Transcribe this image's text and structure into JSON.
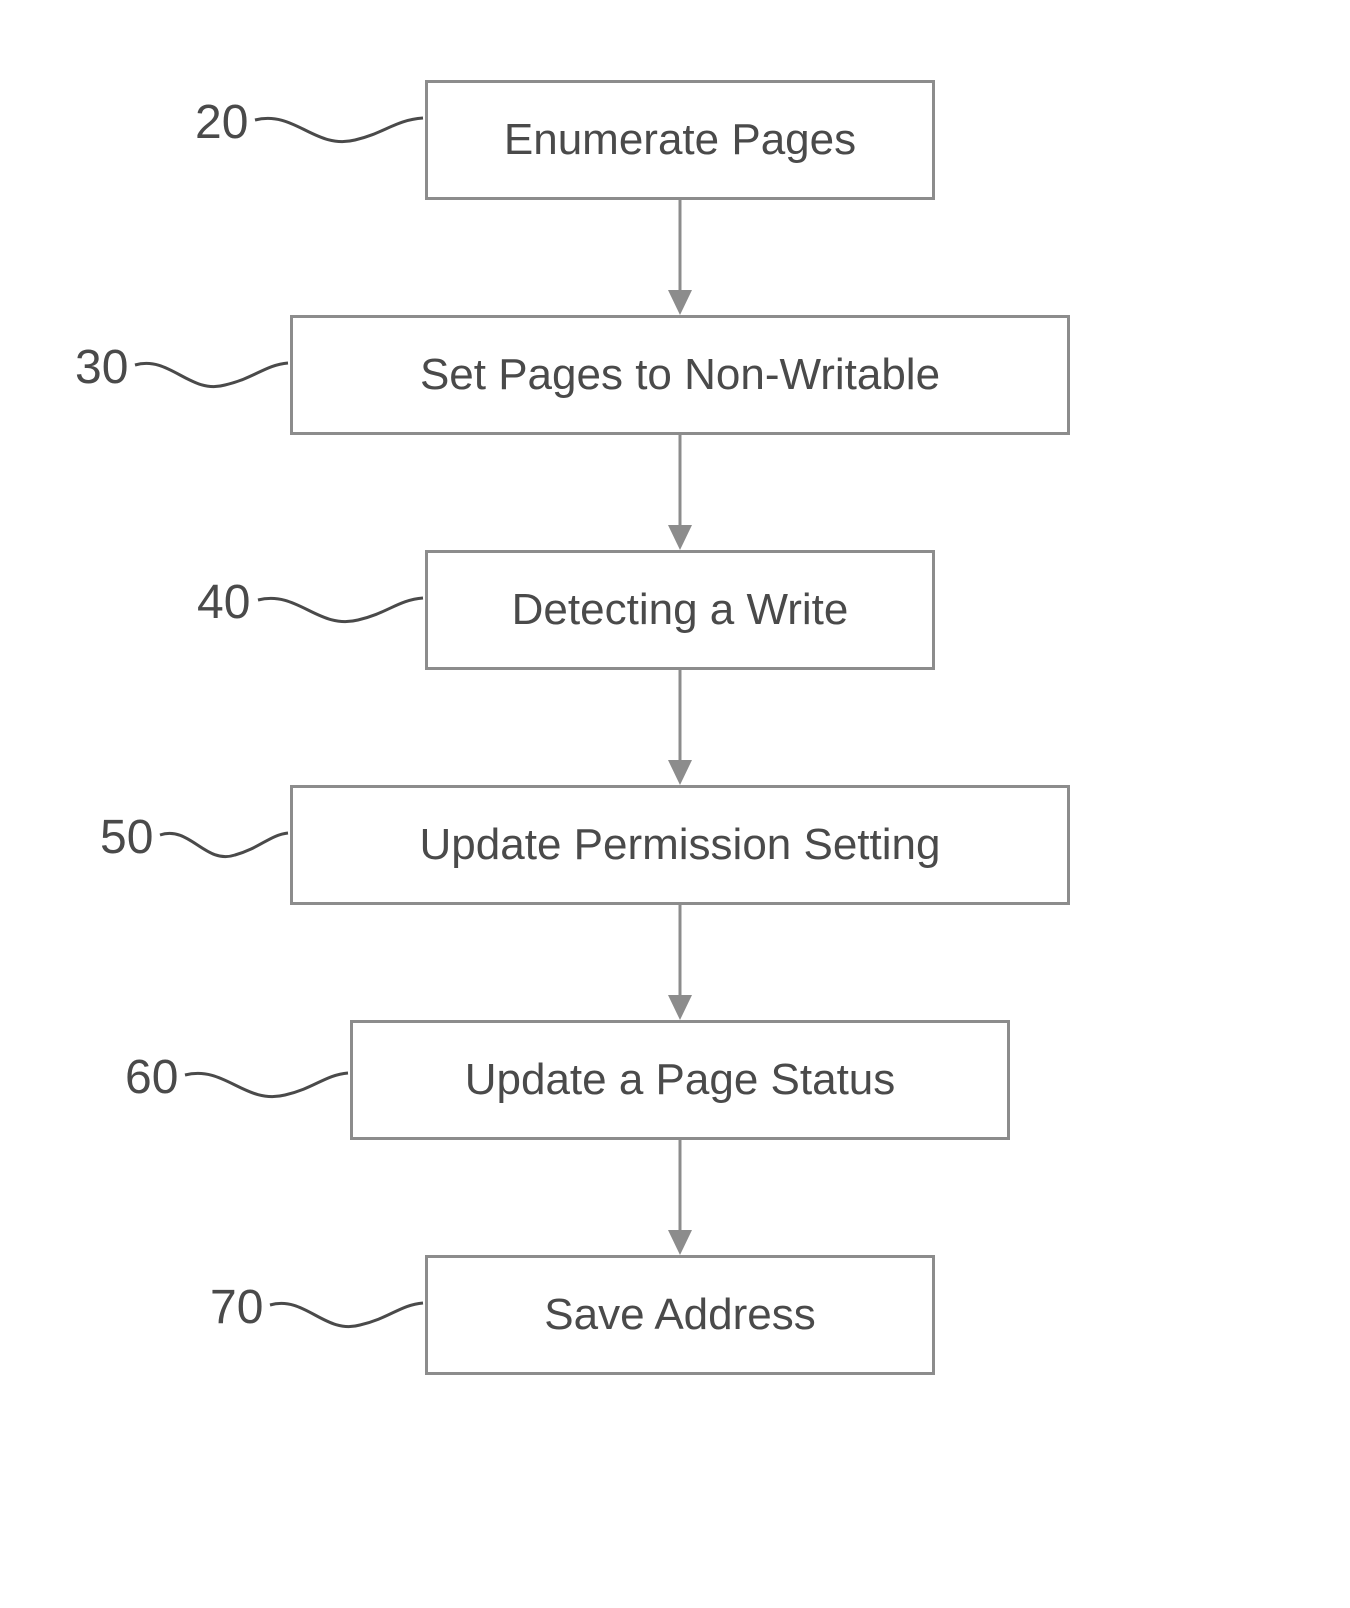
{
  "steps": [
    {
      "ref": "20",
      "label": "Enumerate Pages"
    },
    {
      "ref": "30",
      "label": "Set Pages to Non-Writable"
    },
    {
      "ref": "40",
      "label": "Detecting a Write"
    },
    {
      "ref": "50",
      "label": "Update Permission Setting"
    },
    {
      "ref": "60",
      "label": "Update a Page Status"
    },
    {
      "ref": "70",
      "label": "Save Address"
    }
  ]
}
